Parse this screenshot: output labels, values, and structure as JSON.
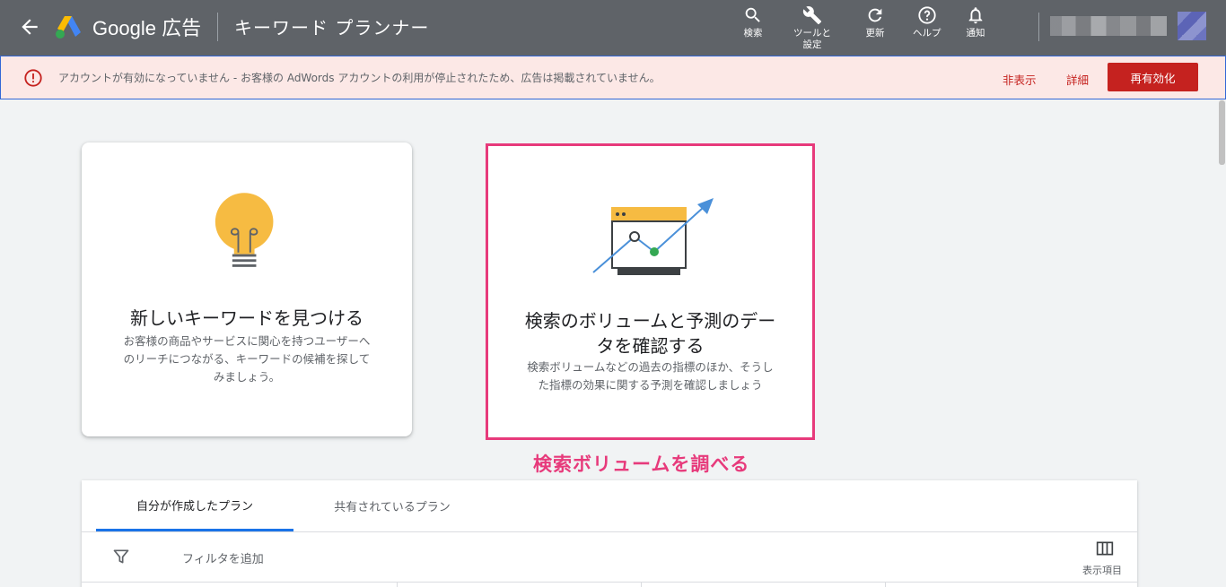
{
  "header": {
    "brand_google": "Google",
    "brand_ads": "広告",
    "tool_title": "キーワード プランナー",
    "actions": [
      {
        "label": "検索",
        "icon": "search-icon"
      },
      {
        "label": "ツールと\n設定",
        "icon": "wrench-icon"
      },
      {
        "label": "更新",
        "icon": "refresh-icon"
      },
      {
        "label": "ヘルプ",
        "icon": "help-icon"
      },
      {
        "label": "通知",
        "icon": "bell-icon"
      }
    ]
  },
  "alert": {
    "message": "アカウントが有効になっていません - お客様の AdWords アカウントの利用が停止されたため、広告は掲載されていません。",
    "hide_label": "非表示",
    "details_label": "詳細",
    "reactivate_label": "再有効化",
    "color": "#c5221f"
  },
  "cards": [
    {
      "title": "新しいキーワードを見つける",
      "description": [
        "お客様の商品やサービスに関心を持つユーザーへ",
        "のリーチにつながる、キーワードの候補を探して",
        "みましょう。"
      ],
      "icon": "lightbulb-icon"
    },
    {
      "title": [
        "検索のボリュームと予測のデー",
        "タを確認する"
      ],
      "description": [
        "検索ボリュームなどの過去の指標のほか、そうし",
        "た指標の効果に関する予測を確認しましょう"
      ],
      "icon": "trend-chart-icon"
    }
  ],
  "annotation": "検索ボリュームを調べる",
  "annotation_color": "#e73a7b",
  "plans": {
    "tabs": [
      "自分が作成したプラン",
      "共有されているプラン"
    ],
    "active_tab": 0,
    "filter_label": "フィルタを追加",
    "columns_label": "表示項目"
  }
}
